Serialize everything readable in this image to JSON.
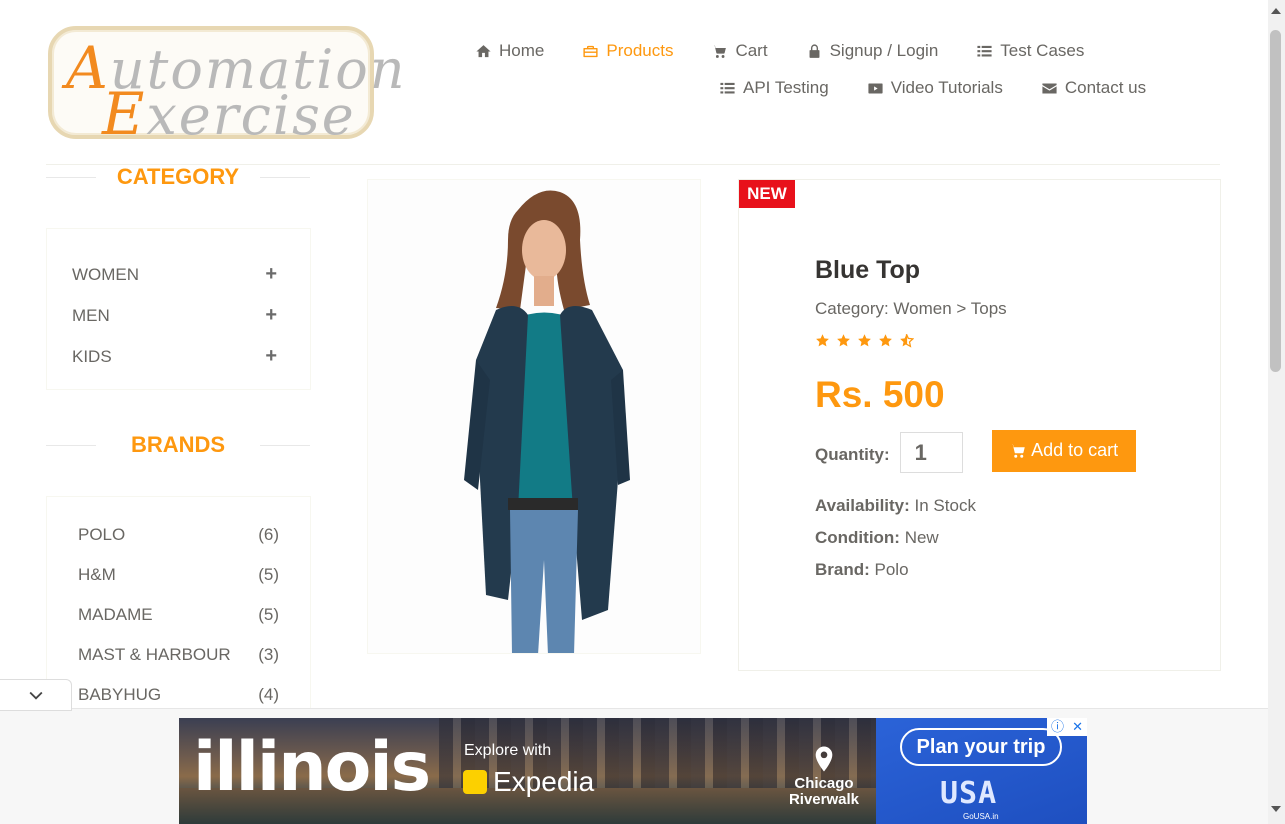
{
  "logo": {
    "line1_cap": "A",
    "line1_rest": "utomation",
    "line2_cap": "E",
    "line2_rest": "xercise"
  },
  "nav": {
    "row1": [
      {
        "label": "Home",
        "icon": "home-icon",
        "active": false
      },
      {
        "label": "Products",
        "icon": "briefcase-icon",
        "active": true
      },
      {
        "label": "Cart",
        "icon": "cart-icon",
        "active": false
      },
      {
        "label": "Signup / Login",
        "icon": "lock-icon",
        "active": false
      },
      {
        "label": "Test Cases",
        "icon": "list-icon",
        "active": false
      }
    ],
    "row2": [
      {
        "label": "API Testing",
        "icon": "list-icon",
        "active": false
      },
      {
        "label": "Video Tutorials",
        "icon": "youtube-play-icon",
        "active": false
      },
      {
        "label": "Contact us",
        "icon": "envelope-icon",
        "active": false
      }
    ]
  },
  "sidebar": {
    "category_title": "CATEGORY",
    "categories": [
      {
        "label": "WOMEN",
        "toggle": "+"
      },
      {
        "label": "MEN",
        "toggle": "+"
      },
      {
        "label": "KIDS",
        "toggle": "+"
      }
    ],
    "brands_title": "BRANDS",
    "brands": [
      {
        "label": "POLO",
        "count": "(6)"
      },
      {
        "label": "H&M",
        "count": "(5)"
      },
      {
        "label": "MADAME",
        "count": "(5)"
      },
      {
        "label": "MAST & HARBOUR",
        "count": "(3)"
      },
      {
        "label": "BABYHUG",
        "count": "(4)"
      }
    ]
  },
  "product": {
    "badge": "NEW",
    "name": "Blue Top",
    "category": "Category: Women > Tops",
    "rating": 4.5,
    "price": "Rs. 500",
    "quantity_label": "Quantity:",
    "quantity_value": "1",
    "add_to_cart": "Add to cart",
    "availability_label": "Availability:",
    "availability_value": "In Stock",
    "condition_label": "Condition:",
    "condition_value": "New",
    "brand_label": "Brand:",
    "brand_value": "Polo"
  },
  "ad": {
    "headline": "illinois",
    "explore": "Explore with",
    "expedia": "Expedia",
    "place": "Chicago Riverwalk",
    "plan": "Plan your trip",
    "usa": "USA",
    "gousa": "GoUSA.in",
    "info_symbol": "ⓘ",
    "close_symbol": "✕"
  },
  "colors": {
    "accent": "#fe980f",
    "badge": "#e8111b",
    "text": "#696763"
  }
}
